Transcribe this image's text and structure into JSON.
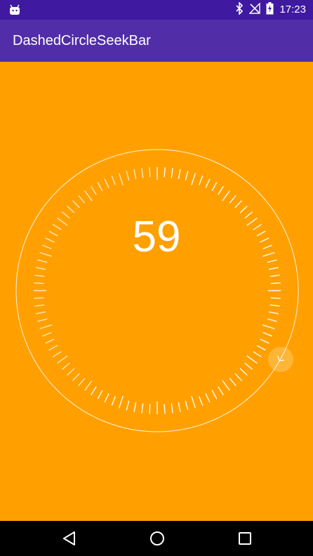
{
  "status_bar": {
    "time": "17:23",
    "icons": [
      "android-icon",
      "bluetooth-icon",
      "no-signal-icon",
      "battery-charging-icon"
    ]
  },
  "app_bar": {
    "title": "DashedCircleSeekBar"
  },
  "seekbar": {
    "value": "59",
    "progress": 0.59,
    "tick_count": 100
  },
  "colors": {
    "background": "#ffa000",
    "status_bar": "#3f1aa0",
    "app_bar": "#512da8",
    "nav_bar": "#000000"
  },
  "nav": {
    "icons": [
      "back-icon",
      "home-icon",
      "recents-icon"
    ]
  }
}
